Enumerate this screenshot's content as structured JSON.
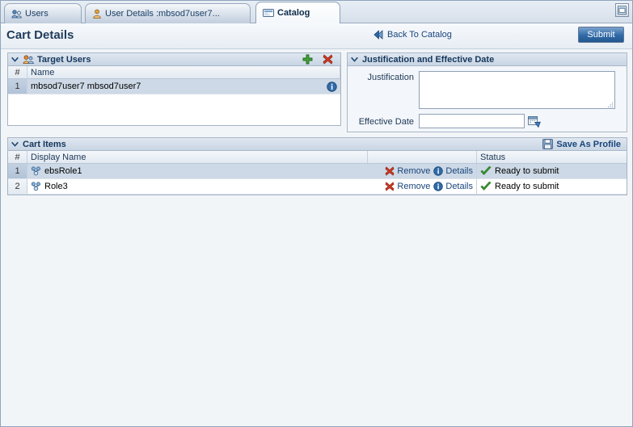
{
  "window": {
    "restore_button_icon": "restore-window-icon"
  },
  "tabs": [
    {
      "label": "Users",
      "icon": "users-icon",
      "active": false
    },
    {
      "label": "User Details :mbsod7user7...",
      "icon": "user-details-icon",
      "active": false
    },
    {
      "label": "Catalog",
      "icon": "catalog-icon",
      "active": true
    }
  ],
  "header": {
    "title": "Cart Details",
    "back_label": "Back To Catalog",
    "back_icon": "back-arrow-icon",
    "submit_label": "Submit"
  },
  "target_users": {
    "panel_title": "Target Users",
    "panel_icon": "target-users-icon",
    "disclosure_icon": "chevron-down-icon",
    "add_icon": "add-green-plus-icon",
    "delete_icon": "delete-red-x-icon",
    "columns": [
      "#",
      "Name"
    ],
    "rows": [
      {
        "index": "1",
        "name": "mbsod7user7 mbsod7user7",
        "info_icon": "info-icon",
        "selected": true
      }
    ]
  },
  "justification": {
    "panel_title": "Justification and Effective Date",
    "disclosure_icon": "chevron-down-icon",
    "justification_label": "Justification",
    "justification_value": "",
    "effective_date_label": "Effective Date",
    "effective_date_value": "",
    "date_picker_icon": "calendar-picker-icon"
  },
  "cart_items": {
    "panel_title": "Cart Items",
    "disclosure_icon": "chevron-down-icon",
    "save_as_profile_label": "Save As Profile",
    "save_as_profile_icon": "save-disk-icon",
    "columns": [
      "#",
      "Display Name",
      "",
      "Status"
    ],
    "rows": [
      {
        "index": "1",
        "display_name": "ebsRole1",
        "row_icon": "role-icon",
        "remove_label": "Remove",
        "remove_icon": "remove-red-x-icon",
        "details_label": "Details",
        "details_icon": "info-icon",
        "status": "Ready to submit",
        "status_icon": "green-check-icon",
        "selected": true
      },
      {
        "index": "2",
        "display_name": "Role3",
        "row_icon": "role-icon",
        "remove_label": "Remove",
        "remove_icon": "remove-red-x-icon",
        "details_label": "Details",
        "details_icon": "info-icon",
        "status": "Ready to submit",
        "status_icon": "green-check-icon",
        "selected": false
      }
    ]
  },
  "colors": {
    "accent_blue": "#19457c",
    "submit_blue": "#2f6aa8",
    "panel_header": "#c9d5e4",
    "selected_row": "#cdd9e6",
    "green": "#3f9c35",
    "red": "#cc3322"
  }
}
